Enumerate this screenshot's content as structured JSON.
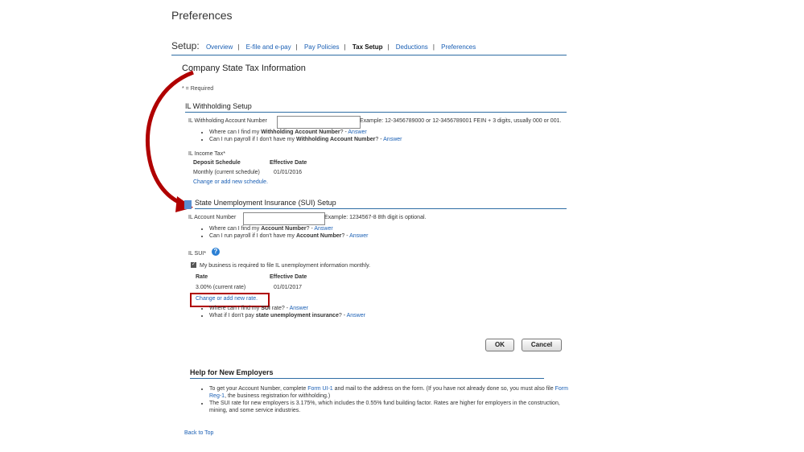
{
  "page": {
    "title": "Preferences"
  },
  "setup_nav": {
    "label": "Setup:",
    "items": [
      "Overview",
      "E-file and e-pay",
      "Pay Policies",
      "Tax Setup",
      "Deductions",
      "Preferences"
    ],
    "separator": "|"
  },
  "company": {
    "heading": "Company State Tax Information",
    "required_note": "* = Required"
  },
  "withholding": {
    "heading": "IL Withholding Setup",
    "account_label": "IL Withholding Account Number",
    "account_value": "",
    "example": "Example: 12-3456789000 or 12-3456789001   FEIN + 3 digits, usually 000 or 001.",
    "hint1_pre": "Where can I find my ",
    "hint1_bold": "Withholding Account Number",
    "hint1_post": "? - ",
    "hint2_pre": "Can I run payroll if I don't have my ",
    "hint2_bold": "Withholding Account Number",
    "hint2_post": "? - ",
    "answer": "Answer",
    "income_tax_label": "IL Income Tax*",
    "col_deposit": "Deposit Schedule",
    "col_effective": "Effective Date",
    "deposit_value": "Monthly (current schedule)",
    "effective_value": "01/01/2016",
    "change_link": "Change or add new schedule."
  },
  "sui": {
    "heading": "State Unemployment Insurance (SUI) Setup",
    "account_label": "IL Account Number",
    "account_value": "",
    "example": "Example: 1234567-8   8th digit is optional.",
    "hint1_pre": "Where can I find my ",
    "hint1_bold": "Account Number",
    "hint1_post": "? - ",
    "hint2_pre": "Can I run payroll if I don't have my ",
    "hint2_bold": "Account Number",
    "hint2_post": "? - ",
    "answer": "Answer",
    "sui_label": "IL SUI*",
    "help_glyph": "?",
    "checkbox_text": "My business is required to file IL unemployment information monthly.",
    "checkbox_checked": true,
    "col_rate": "Rate",
    "col_effective": "Effective Date",
    "rate_value": "3.00% (current rate)",
    "effective_value": "01/01/2017",
    "change_link": "Change or add new rate.",
    "hint3_pre": "Where can I find my ",
    "hint3_bold": "SUI",
    "hint3_post": " rate? - ",
    "hint4_pre": "What if I don't pay ",
    "hint4_bold": "state unemployment insurance",
    "hint4_post": "? - "
  },
  "buttons": {
    "ok": "OK",
    "cancel": "Cancel"
  },
  "help": {
    "heading": "Help for New Employers",
    "b1_a": "To get your Account Number, complete ",
    "b1_link1": "Form UI-1",
    "b1_b": " and mail to the address on the form. (If you have not already done so, you must also file ",
    "b1_link2": "Form Reg-1",
    "b1_c": ", the business registration for withholding.)",
    "b2": "The SUI rate for new employers is 3.175%, which includes the 0.55% fund building factor. Rates are higher for employers in the construction, mining, and some service industries."
  },
  "back_to_top": "Back to Top",
  "colors": {
    "link": "#1a5fb4",
    "rule": "#2e6da4",
    "annotation": "#b00000"
  }
}
